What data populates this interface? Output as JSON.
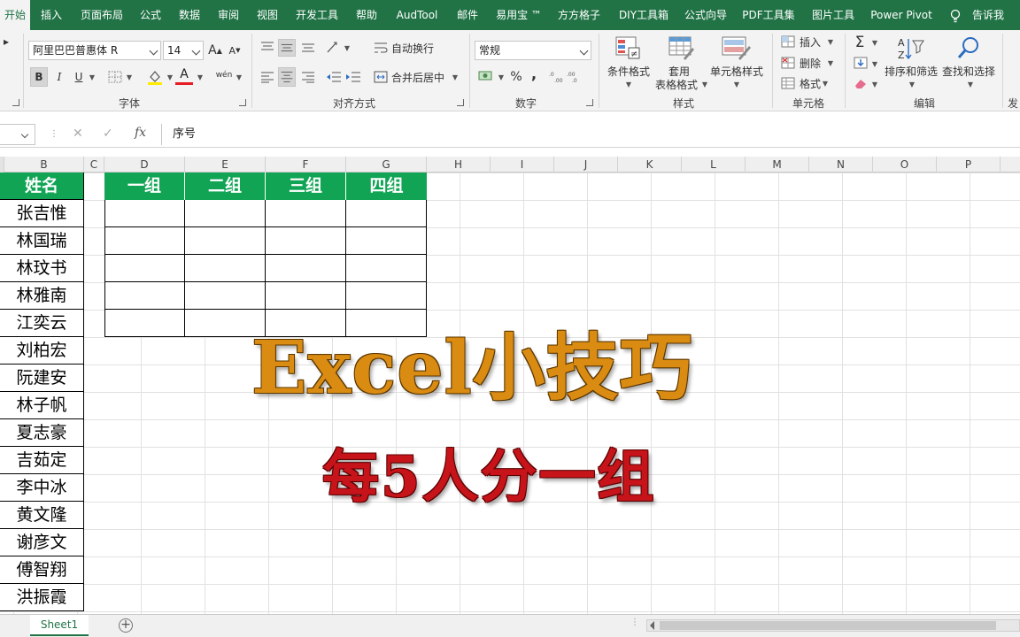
{
  "ribbon": {
    "tabs": [
      "开始",
      "插入",
      "页面布局",
      "公式",
      "数据",
      "审阅",
      "视图",
      "开发工具",
      "帮助",
      "AudTool",
      "邮件",
      "易用宝 ™",
      "方方格子",
      "DIY工具箱",
      "公式向导",
      "PDF工具集",
      "图片工具",
      "Power Pivot",
      "告诉我"
    ],
    "active_tab": "开始",
    "font": {
      "name": "阿里巴巴普惠体 R",
      "size": "14",
      "bold": "B",
      "italic": "I",
      "underline": "U",
      "grow": "A",
      "shrink": "A",
      "font_color_glyph": "A",
      "phonetic": "wén",
      "group_label": "字体"
    },
    "alignment": {
      "wrap_text": "自动换行",
      "merge_center": "合并后居中",
      "group_label": "对齐方式"
    },
    "number": {
      "format": "常规",
      "percent": "%",
      "comma": ",",
      "group_label": "数字"
    },
    "styles": {
      "conditional": "条件格式",
      "table_line1": "套用",
      "table_line2": "表格格式",
      "cell_styles": "单元格样式",
      "group_label": "样式"
    },
    "cells": {
      "insert": "插入",
      "delete": "删除",
      "format": "格式",
      "group_label": "单元格"
    },
    "editing": {
      "sum": "Σ",
      "sort_filter": "排序和筛选",
      "find_select": "查找和选择",
      "group_label": "编辑",
      "cutoff_label": "发"
    }
  },
  "formula_bar": {
    "cancel": "✕",
    "enter": "✓",
    "fx": "fx",
    "content": "序号"
  },
  "columns": [
    "B",
    "C",
    "D",
    "E",
    "F",
    "G",
    "H",
    "I",
    "J",
    "K",
    "L",
    "M",
    "N",
    "O",
    "P"
  ],
  "table": {
    "name_header": "姓名",
    "names": [
      "张吉惟",
      "林国瑞",
      "林玟书",
      "林雅南",
      "江奕云",
      "刘柏宏",
      "阮建安",
      "林子帆",
      "夏志豪",
      "吉茹定",
      "李中冰",
      "黄文隆",
      "谢彦文",
      "傅智翔",
      "洪振霞"
    ],
    "group_headers": [
      "一组",
      "二组",
      "三组",
      "四组"
    ]
  },
  "overlay": {
    "title": "Excel小技巧",
    "subtitle": "每5人分一组"
  },
  "sheets": {
    "active": "Sheet1",
    "add": "+"
  },
  "colors": {
    "excel_green": "#217346",
    "header_green": "#10a454",
    "title_orange": "#d98b12",
    "subtitle_red": "#c7141a"
  }
}
